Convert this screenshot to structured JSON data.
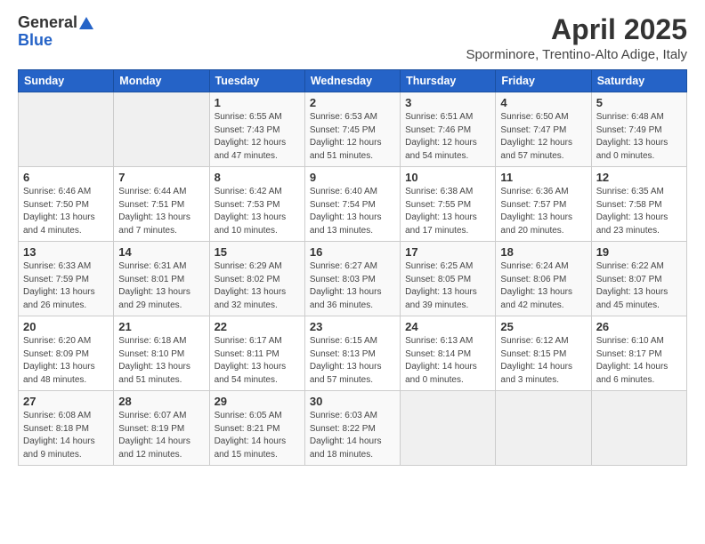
{
  "header": {
    "logo_general": "General",
    "logo_blue": "Blue",
    "title": "April 2025",
    "subtitle": "Sporminore, Trentino-Alto Adige, Italy"
  },
  "days_of_week": [
    "Sunday",
    "Monday",
    "Tuesday",
    "Wednesday",
    "Thursday",
    "Friday",
    "Saturday"
  ],
  "weeks": [
    [
      {
        "day": "",
        "info": ""
      },
      {
        "day": "",
        "info": ""
      },
      {
        "day": "1",
        "info": "Sunrise: 6:55 AM\nSunset: 7:43 PM\nDaylight: 12 hours and 47 minutes."
      },
      {
        "day": "2",
        "info": "Sunrise: 6:53 AM\nSunset: 7:45 PM\nDaylight: 12 hours and 51 minutes."
      },
      {
        "day": "3",
        "info": "Sunrise: 6:51 AM\nSunset: 7:46 PM\nDaylight: 12 hours and 54 minutes."
      },
      {
        "day": "4",
        "info": "Sunrise: 6:50 AM\nSunset: 7:47 PM\nDaylight: 12 hours and 57 minutes."
      },
      {
        "day": "5",
        "info": "Sunrise: 6:48 AM\nSunset: 7:49 PM\nDaylight: 13 hours and 0 minutes."
      }
    ],
    [
      {
        "day": "6",
        "info": "Sunrise: 6:46 AM\nSunset: 7:50 PM\nDaylight: 13 hours and 4 minutes."
      },
      {
        "day": "7",
        "info": "Sunrise: 6:44 AM\nSunset: 7:51 PM\nDaylight: 13 hours and 7 minutes."
      },
      {
        "day": "8",
        "info": "Sunrise: 6:42 AM\nSunset: 7:53 PM\nDaylight: 13 hours and 10 minutes."
      },
      {
        "day": "9",
        "info": "Sunrise: 6:40 AM\nSunset: 7:54 PM\nDaylight: 13 hours and 13 minutes."
      },
      {
        "day": "10",
        "info": "Sunrise: 6:38 AM\nSunset: 7:55 PM\nDaylight: 13 hours and 17 minutes."
      },
      {
        "day": "11",
        "info": "Sunrise: 6:36 AM\nSunset: 7:57 PM\nDaylight: 13 hours and 20 minutes."
      },
      {
        "day": "12",
        "info": "Sunrise: 6:35 AM\nSunset: 7:58 PM\nDaylight: 13 hours and 23 minutes."
      }
    ],
    [
      {
        "day": "13",
        "info": "Sunrise: 6:33 AM\nSunset: 7:59 PM\nDaylight: 13 hours and 26 minutes."
      },
      {
        "day": "14",
        "info": "Sunrise: 6:31 AM\nSunset: 8:01 PM\nDaylight: 13 hours and 29 minutes."
      },
      {
        "day": "15",
        "info": "Sunrise: 6:29 AM\nSunset: 8:02 PM\nDaylight: 13 hours and 32 minutes."
      },
      {
        "day": "16",
        "info": "Sunrise: 6:27 AM\nSunset: 8:03 PM\nDaylight: 13 hours and 36 minutes."
      },
      {
        "day": "17",
        "info": "Sunrise: 6:25 AM\nSunset: 8:05 PM\nDaylight: 13 hours and 39 minutes."
      },
      {
        "day": "18",
        "info": "Sunrise: 6:24 AM\nSunset: 8:06 PM\nDaylight: 13 hours and 42 minutes."
      },
      {
        "day": "19",
        "info": "Sunrise: 6:22 AM\nSunset: 8:07 PM\nDaylight: 13 hours and 45 minutes."
      }
    ],
    [
      {
        "day": "20",
        "info": "Sunrise: 6:20 AM\nSunset: 8:09 PM\nDaylight: 13 hours and 48 minutes."
      },
      {
        "day": "21",
        "info": "Sunrise: 6:18 AM\nSunset: 8:10 PM\nDaylight: 13 hours and 51 minutes."
      },
      {
        "day": "22",
        "info": "Sunrise: 6:17 AM\nSunset: 8:11 PM\nDaylight: 13 hours and 54 minutes."
      },
      {
        "day": "23",
        "info": "Sunrise: 6:15 AM\nSunset: 8:13 PM\nDaylight: 13 hours and 57 minutes."
      },
      {
        "day": "24",
        "info": "Sunrise: 6:13 AM\nSunset: 8:14 PM\nDaylight: 14 hours and 0 minutes."
      },
      {
        "day": "25",
        "info": "Sunrise: 6:12 AM\nSunset: 8:15 PM\nDaylight: 14 hours and 3 minutes."
      },
      {
        "day": "26",
        "info": "Sunrise: 6:10 AM\nSunset: 8:17 PM\nDaylight: 14 hours and 6 minutes."
      }
    ],
    [
      {
        "day": "27",
        "info": "Sunrise: 6:08 AM\nSunset: 8:18 PM\nDaylight: 14 hours and 9 minutes."
      },
      {
        "day": "28",
        "info": "Sunrise: 6:07 AM\nSunset: 8:19 PM\nDaylight: 14 hours and 12 minutes."
      },
      {
        "day": "29",
        "info": "Sunrise: 6:05 AM\nSunset: 8:21 PM\nDaylight: 14 hours and 15 minutes."
      },
      {
        "day": "30",
        "info": "Sunrise: 6:03 AM\nSunset: 8:22 PM\nDaylight: 14 hours and 18 minutes."
      },
      {
        "day": "",
        "info": ""
      },
      {
        "day": "",
        "info": ""
      },
      {
        "day": "",
        "info": ""
      }
    ]
  ]
}
